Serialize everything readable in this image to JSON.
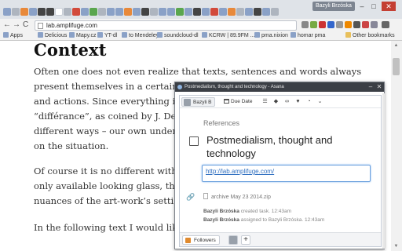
{
  "browser": {
    "profile_name": "Bazyli Brzóska",
    "url": "lab.amplifuge.com",
    "window_controls": {
      "minimize": "–",
      "maximize": "□",
      "close": "✕"
    },
    "nav": {
      "back": "←",
      "forward": "→",
      "reload": "C"
    },
    "bookmarks": [
      {
        "label": "Apps",
        "icon": "apps-icon"
      },
      {
        "label": "Delicious",
        "icon": "delicious-icon"
      },
      {
        "label": "Mapy.cz",
        "icon": "mapy-icon"
      },
      {
        "label": "YT-dl",
        "icon": "youtube-icon"
      },
      {
        "label": "to Mendeley",
        "icon": "mendeley-icon"
      },
      {
        "label": "soundcloud-dl",
        "icon": "soundcloud-icon"
      },
      {
        "label": "KCRW | 89.9FM ...",
        "icon": "kcrw-icon"
      },
      {
        "label": "pma.nixion",
        "icon": "pma-icon"
      },
      {
        "label": "homar pma",
        "icon": "pma-icon"
      },
      {
        "label": "Other bookmarks",
        "icon": "folder-icon"
      }
    ]
  },
  "article": {
    "title": "Context",
    "lines": [
      "Often one does not even realize that texts, sentences and words always",
      "present themselves in a certain",
      "and actions. Since everything is",
      "“différance”, as coined by J. De",
      "different ways – our own under",
      "on the situation.",
      "Of course it is no different with",
      "only available looking glass, thro",
      "nuances of the art-work’s setti",
      "In the following text I would lik"
    ]
  },
  "asana": {
    "window_title": "Postmedialism, thought and technology - Asana",
    "assignee": "Bazyli B",
    "due_date_label": "Due Date",
    "section_heading": "References",
    "task_name": "Postmedialism, thought and technology",
    "notes_link": "http://lab.amplifuge.com/",
    "attachment_name": "archive May 23 2014.zip",
    "stories": [
      {
        "author": "Bazyli Brzóska",
        "action": "created task.",
        "time": "12:43am"
      },
      {
        "author": "Bazyli Brzóska",
        "action": "assigned to Bazyli Brzóska.",
        "time": "12:43am"
      }
    ],
    "followers_label": "Followers",
    "add_follower": "+"
  }
}
